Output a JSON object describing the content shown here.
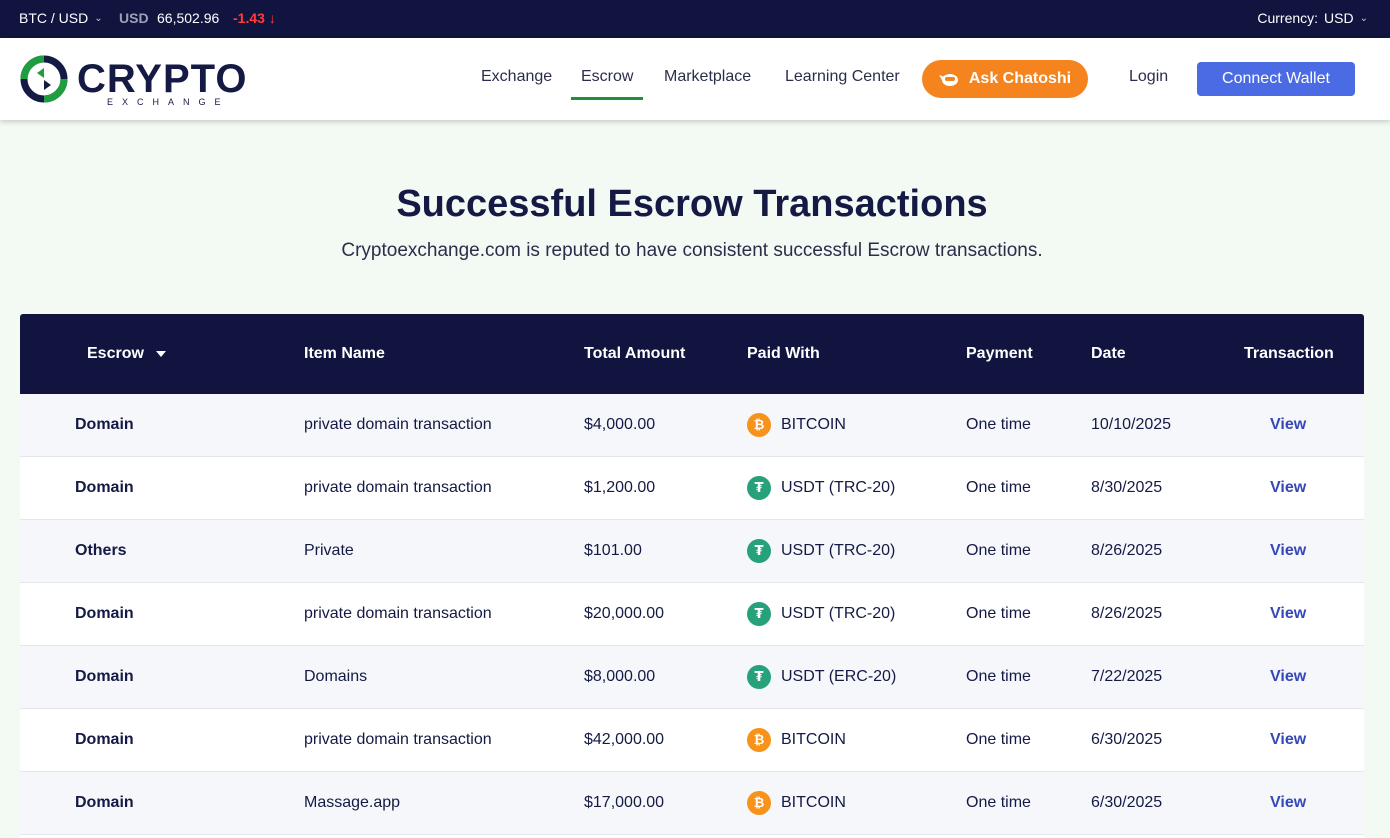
{
  "ticker": {
    "pair": "BTC / USD",
    "currency_code": "USD",
    "price": "66,502.96",
    "change": "-1.43",
    "change_arrow": "↓",
    "currency_label": "Currency:",
    "currency_value": "USD"
  },
  "header": {
    "logo_main": "CRYPTO",
    "logo_sub": "EXCHANGE",
    "nav": [
      {
        "label": "Exchange"
      },
      {
        "label": "Escrow"
      },
      {
        "label": "Marketplace"
      },
      {
        "label": "Learning Center"
      }
    ],
    "ask_label": "Ask Chatoshi",
    "login_label": "Login",
    "connect_label": "Connect Wallet"
  },
  "hero": {
    "title": "Successful Escrow Transactions",
    "subtitle": "Cryptoexchange.com is reputed to have consistent successful Escrow transactions."
  },
  "table": {
    "columns": [
      "Escrow",
      "Item Name",
      "Total Amount",
      "Paid With",
      "Payment",
      "Date",
      "Transaction"
    ],
    "rows": [
      {
        "escrow": "Domain",
        "item": "private domain transaction",
        "amount": "$4,000.00",
        "paid": "BITCOIN",
        "coin": "btc",
        "payment": "One time",
        "date": "10/10/2025",
        "action": "View"
      },
      {
        "escrow": "Domain",
        "item": "private domain transaction",
        "amount": "$1,200.00",
        "paid": "USDT (TRC-20)",
        "coin": "usdt",
        "payment": "One time",
        "date": "8/30/2025",
        "action": "View"
      },
      {
        "escrow": "Others",
        "item": "Private",
        "amount": "$101.00",
        "paid": "USDT (TRC-20)",
        "coin": "usdt",
        "payment": "One time",
        "date": "8/26/2025",
        "action": "View"
      },
      {
        "escrow": "Domain",
        "item": "private domain transaction",
        "amount": "$20,000.00",
        "paid": "USDT (TRC-20)",
        "coin": "usdt",
        "payment": "One time",
        "date": "8/26/2025",
        "action": "View"
      },
      {
        "escrow": "Domain",
        "item": "Domains",
        "amount": "$8,000.00",
        "paid": "USDT (ERC-20)",
        "coin": "usdt",
        "payment": "One time",
        "date": "7/22/2025",
        "action": "View"
      },
      {
        "escrow": "Domain",
        "item": "private domain transaction",
        "amount": "$42,000.00",
        "paid": "BITCOIN",
        "coin": "btc",
        "payment": "One time",
        "date": "6/30/2025",
        "action": "View"
      },
      {
        "escrow": "Domain",
        "item": "Massage.app",
        "amount": "$17,000.00",
        "paid": "BITCOIN",
        "coin": "btc",
        "payment": "One time",
        "date": "6/30/2025",
        "action": "View"
      }
    ]
  },
  "colors": {
    "navy": "#10143f",
    "accent_orange": "#f5841f",
    "accent_blue": "#4a6be4",
    "active_green": "#1e8f3a",
    "negative_red": "#ff3b3b",
    "bitcoin": "#f7931a",
    "tether": "#26a17b"
  },
  "icons": {
    "bitcoin": "bitcoin-icon",
    "tether": "tether-icon",
    "sort": "caret-down-icon",
    "dropdown": "chevron-down-icon"
  }
}
